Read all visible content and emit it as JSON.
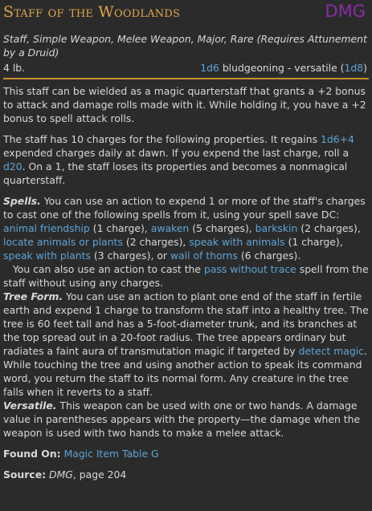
{
  "header": {
    "title": "Staff of the Woodlands",
    "source_badge": "DMG"
  },
  "item": {
    "type_line": "Staff, Simple Weapon, Melee Weapon, Major, Rare (Requires Attunement by a Druid)",
    "weight": "4 lb.",
    "damage_dice": "1d6",
    "damage_text": " bludgeoning - versatile (",
    "versatile_dice": "1d8",
    "damage_close": ")"
  },
  "body": {
    "p1": "This staff can be wielded as a magic quarterstaff that grants a +2 bonus to attack and damage rolls made with it. While holding it, you have a +2 bonus to spell attack rolls.",
    "p2a": "The staff has 10 charges for the following properties. It regains ",
    "p2_regain": "1d6+4",
    "p2b": " expended charges daily at dawn. If you expend the last charge, roll a ",
    "p2_d20": "d20",
    "p2c": ". On a 1, the staff loses its properties and becomes a nonmagical quarterstaff.",
    "spells_head": "Spells.",
    "spells_a": " You can use an action to expend 1 or more of the staff's charges to cast one of the following spells from it, using your spell save DC: ",
    "sp1": "animal friendship",
    "sp1c": " (1 charge), ",
    "sp2": "awaken",
    "sp2c": " (5 charges), ",
    "sp3": "barkskin",
    "sp3c": " (2 charges), ",
    "sp4": "locate animals or plants",
    "sp4c": " (2 charges), ",
    "sp5": "speak with animals",
    "sp5c": " (1 charge), ",
    "sp6": "speak with plants",
    "sp6c": " (3 charges), or ",
    "sp7": "wall of thorns",
    "sp7c": " (6 charges).",
    "pass_a": "You can also use an action to cast the ",
    "pass_link": "pass without trace",
    "pass_b": " spell from the staff without using any charges.",
    "tree_head": "Tree Form.",
    "tree_a": " You can use an action to plant one end of the staff in fertile earth and expend 1 charge to transform the staff into a healthy tree. The tree is 60 feet tall and has a 5-foot-diameter trunk, and its branches at the top spread out in a 20-foot radius. The tree appears ordinary but radiates a faint aura of transmutation magic if targeted by ",
    "tree_link": "detect magic",
    "tree_b": ". While touching the tree and using another action to speak its command word, you return the staff to its normal form. Any creature in the tree falls when it reverts to a staff.",
    "vers_head": "Versatile.",
    "vers_a": " This weapon can be used with one or two hands. A damage value in parentheses appears with the property—the damage when the weapon is used with two hands to make a melee attack."
  },
  "footer": {
    "found_label": "Found On:",
    "found_link": "Magic Item Table G",
    "source_label": "Source:",
    "source_book": "DMG",
    "source_page": ", page 204"
  }
}
